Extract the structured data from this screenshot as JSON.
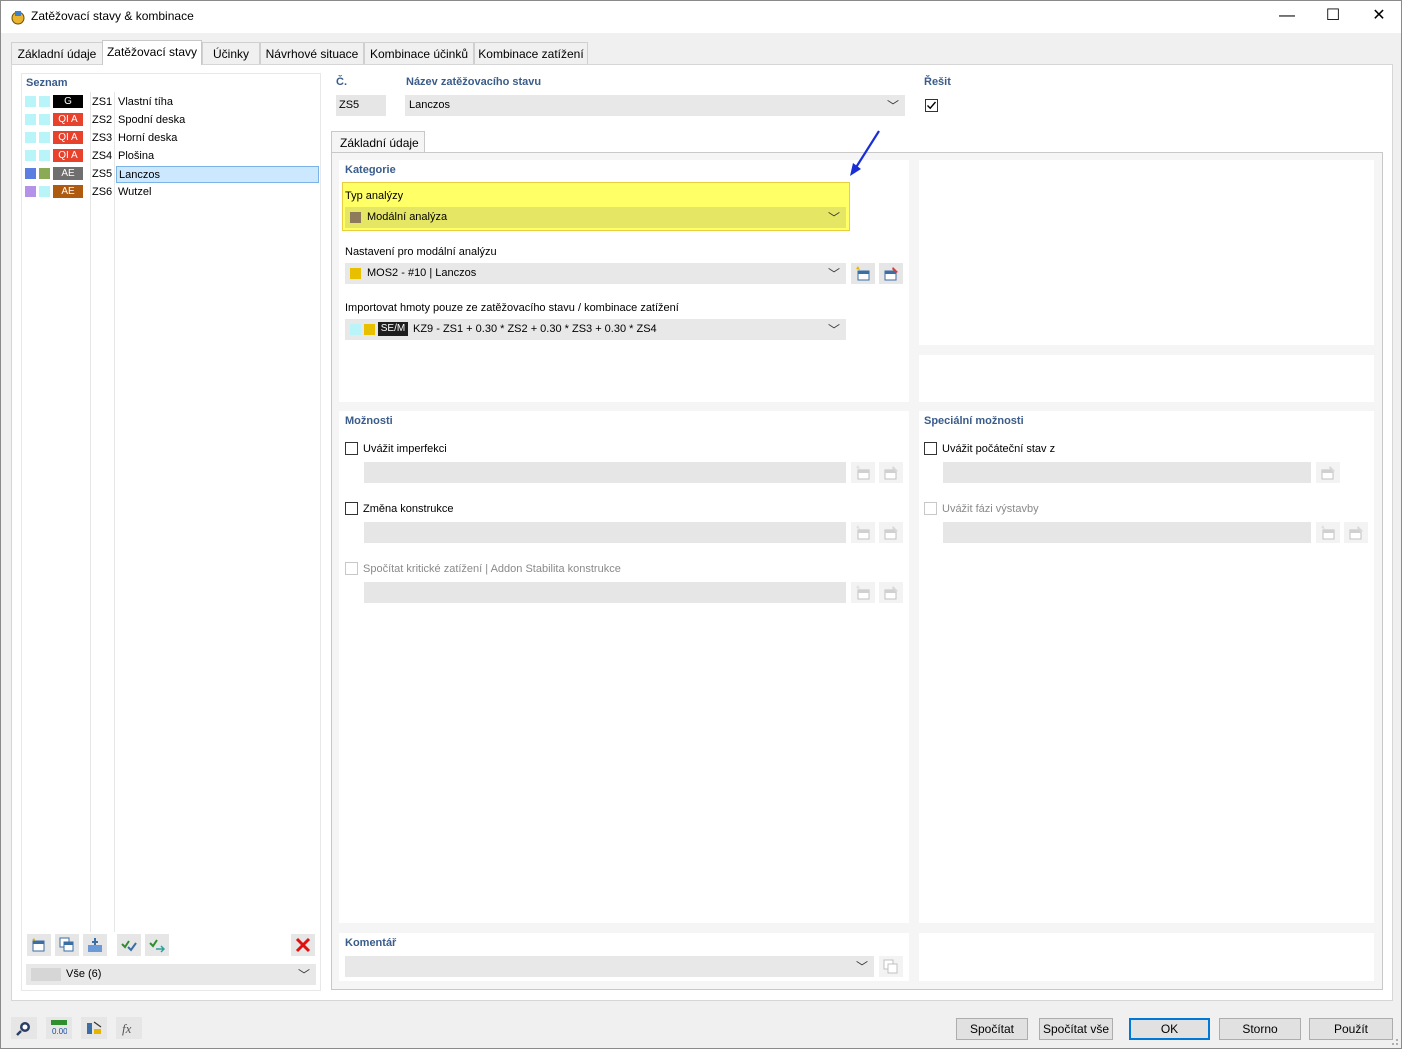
{
  "window": {
    "title": "Zatěžovací stavy & kombinace",
    "minimize": "—",
    "maximize": "☐",
    "close": "✕"
  },
  "tabs": [
    {
      "label": "Základní údaje"
    },
    {
      "label": "Zatěžovací stavy"
    },
    {
      "label": "Účinky"
    },
    {
      "label": "Návrhové situace"
    },
    {
      "label": "Kombinace účinků"
    },
    {
      "label": "Kombinace zatížení"
    }
  ],
  "list": {
    "header": "Seznam",
    "items": [
      {
        "code": "ZS1",
        "name": "Vlastní tíha",
        "badge": "G",
        "badge_color": "#000000",
        "sw1": "#b8f4f8",
        "sw2": "#b8f4f8"
      },
      {
        "code": "ZS2",
        "name": "Spodní deska",
        "badge": "QI A",
        "badge_color": "#e8412c",
        "sw1": "#b8f4f8",
        "sw2": "#b8f4f8"
      },
      {
        "code": "ZS3",
        "name": "Horní deska",
        "badge": "QI A",
        "badge_color": "#e8412c",
        "sw1": "#b8f4f8",
        "sw2": "#b8f4f8"
      },
      {
        "code": "ZS4",
        "name": "Plošina",
        "badge": "QI A",
        "badge_color": "#e8412c",
        "sw1": "#b8f4f8",
        "sw2": "#b8f4f8"
      },
      {
        "code": "ZS5",
        "name": "Lanczos",
        "badge": "AE",
        "badge_color": "#6f6f6f",
        "sw1": "#5b7fe0",
        "sw2": "#8aaa55"
      },
      {
        "code": "ZS6",
        "name": "Wutzel",
        "badge": "AE",
        "badge_color": "#b05a10",
        "sw1": "#b592ea",
        "sw2": "#b8f4f8"
      }
    ],
    "filter_value": "Vše (6)"
  },
  "header": {
    "number_label": "Č.",
    "number_value": "ZS5",
    "name_label": "Název zatěžovacího stavu",
    "name_value": "Lanczos",
    "solve_label": "Řešit"
  },
  "subtab": "Základní údaje",
  "category": {
    "title": "Kategorie",
    "analysis_type_label": "Typ analýzy",
    "analysis_type_value": "Modální analýza",
    "modal_settings_label": "Nastavení pro modální analýzu",
    "modal_settings_value": "MOS2 - #10 | Lanczos",
    "import_masses_label": "Importovat hmoty pouze ze zatěžovacího stavu / kombinace zatížení",
    "import_masses_badge": "SE/M",
    "import_masses_value": "KZ9 - ZS1 + 0.30 * ZS2 + 0.30 * ZS3 + 0.30 * ZS4"
  },
  "options": {
    "title": "Možnosti",
    "imperfection_label": "Uvážit imperfekci",
    "structure_change_label": "Změna konstrukce",
    "critical_load_label": "Spočítat kritické zatížení | Addon Stabilita konstrukce"
  },
  "special": {
    "title": "Speciální možnosti",
    "initial_state_label": "Uvážit počáteční stav z",
    "construction_stage_label": "Uvážit fázi výstavby"
  },
  "comment": {
    "title": "Komentář"
  },
  "buttons": {
    "calculate": "Spočítat",
    "calculate_all": "Spočítat vše",
    "ok": "OK",
    "cancel": "Storno",
    "apply": "Použít"
  },
  "colors": {
    "highlight": "#ffff33",
    "section_header": "#3a5c8a",
    "selection": "#cce8ff",
    "ok_border": "#0078d7",
    "arrow": "#1a2ed8"
  }
}
